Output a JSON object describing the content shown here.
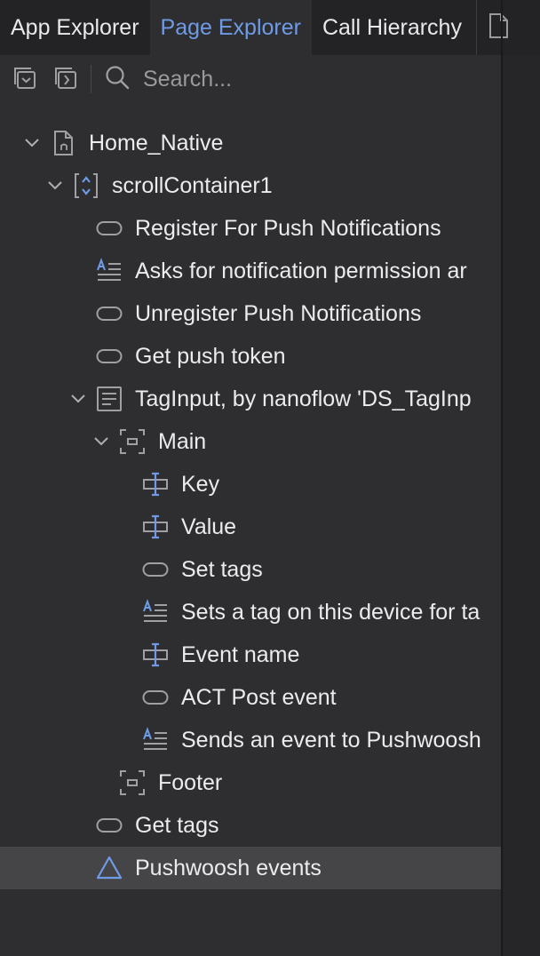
{
  "tabs": [
    {
      "label": "App Explorer",
      "active": false
    },
    {
      "label": "Page Explorer",
      "active": true
    },
    {
      "label": "Call Hierarchy",
      "active": false
    }
  ],
  "toolbar": {
    "collapse_all_icon": "collapse-all-icon",
    "expand_all_icon": "expand-all-icon",
    "search_placeholder": "Search..."
  },
  "tree": {
    "page": "Home_Native",
    "scroll_container": "scrollContainer1",
    "register_button": "Register For Push Notifications",
    "asks_text": "Asks for notification permission ar",
    "unregister_button": "Unregister Push Notifications",
    "get_token_button": "Get push token",
    "tag_input_snippet": "TagInput, by nanoflow 'DS_TagInp",
    "main_container": "Main",
    "key_field": "Key",
    "value_field": "Value",
    "set_tags_button": "Set tags",
    "sets_tag_text": "Sets a tag on this device for ta",
    "event_name_field": "Event name",
    "post_event_button": "ACT Post event",
    "sends_event_text": "Sends an event to Pushwoosh",
    "footer_container": "Footer",
    "get_tags_button": "Get tags",
    "pushwoosh_events": "Pushwoosh events"
  },
  "colors": {
    "accent": "#6f9be6",
    "background": "#2e2e30",
    "tabbar": "#232325",
    "selected_row": "#454548"
  }
}
